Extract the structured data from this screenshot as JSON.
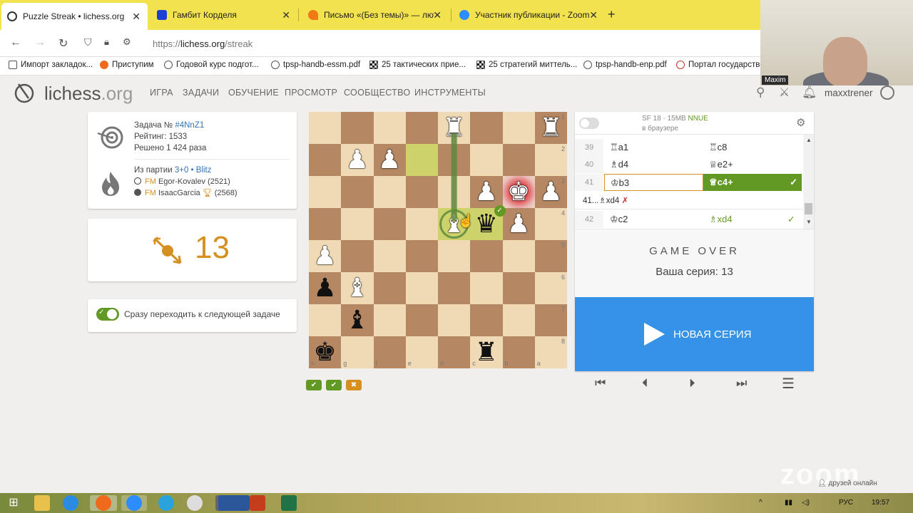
{
  "browser": {
    "tabs": [
      {
        "title": "Puzzle Streak • lichess.org",
        "active": true
      },
      {
        "title": "Гамбит Корделя",
        "active": false
      },
      {
        "title": "Письмо «(Без темы)» — люты",
        "active": false
      },
      {
        "title": "Участник публикации - Zoom",
        "active": false
      }
    ],
    "url_prefix": "https://",
    "url_host": "lichess.org",
    "url_path": "/streak",
    "bookmarks": [
      "Импорт закладок...",
      "Приступим",
      "Годовой курс подгот...",
      "tpsp-handb-essm.pdf",
      "25 тактических прие...",
      "25 стратегий миттель...",
      "tpsp-handb-enp.pdf",
      "Портал государстве"
    ]
  },
  "webcam": {
    "name": "Maxim"
  },
  "lichess": {
    "logo_main": "lichess",
    "logo_tld": ".org",
    "nav": [
      "ИГРА",
      "ЗАДАЧИ",
      "ОБУЧЕНИЕ",
      "ПРОСМОТР",
      "СООБЩЕСТВО",
      "ИНСТРУМЕНТЫ"
    ],
    "username": "maxxtrener"
  },
  "puzzle": {
    "label": "Задача №",
    "id": "#4NnZ1",
    "rating": "Рейтинг: 1533",
    "solved": "Решено 1 424 раза",
    "from_game": "Из партии",
    "time_control": "3+0",
    "speed": "• Blitz",
    "white_title": "FM",
    "white_player": "Egor-Kovalev (2521)",
    "black_title": "FM",
    "black_player": "IsaacGarcia",
    "black_rating": "(2568)",
    "streak": "13",
    "auto_next": "Сразу переходить к следующей задаче",
    "auto_next_on": true
  },
  "board": {
    "files": [
      "h",
      "g",
      "f",
      "e",
      "d",
      "c",
      "b",
      "a"
    ],
    "ranks": [
      "1",
      "2",
      "3",
      "4",
      "5",
      "6",
      "7",
      "8"
    ],
    "pieces": [
      {
        "sq": "d1",
        "glyph": "♜",
        "color": "w"
      },
      {
        "sq": "a1",
        "glyph": "♜",
        "color": "w"
      },
      {
        "sq": "g2",
        "glyph": "♟",
        "color": "w"
      },
      {
        "sq": "f2",
        "glyph": "♟",
        "color": "w"
      },
      {
        "sq": "c3",
        "glyph": "♟",
        "color": "w"
      },
      {
        "sq": "b3",
        "glyph": "♚",
        "color": "w"
      },
      {
        "sq": "a3",
        "glyph": "♟",
        "color": "w"
      },
      {
        "sq": "d4",
        "glyph": "♝",
        "color": "w"
      },
      {
        "sq": "c4",
        "glyph": "♛",
        "color": "b"
      },
      {
        "sq": "b4",
        "glyph": "♟",
        "color": "w"
      },
      {
        "sq": "h5",
        "glyph": "♟",
        "color": "w"
      },
      {
        "sq": "h6",
        "glyph": "♟",
        "color": "b"
      },
      {
        "sq": "g6",
        "glyph": "♝",
        "color": "w"
      },
      {
        "sq": "g7",
        "glyph": "♝",
        "color": "b"
      },
      {
        "sq": "h8",
        "glyph": "♚",
        "color": "b"
      },
      {
        "sq": "c8",
        "glyph": "♜",
        "color": "b"
      }
    ],
    "highlights": [
      {
        "sq": "e2",
        "color": "#cdd26a"
      },
      {
        "sq": "c4",
        "color": "#cdd26a"
      },
      {
        "sq": "d4",
        "color": "#cdd26a"
      }
    ],
    "check_square": "b3",
    "arrow": {
      "from": "d1",
      "to": "d4",
      "color": "#5c8a3d"
    },
    "result_icons": [
      "✔",
      "✔",
      "✖"
    ]
  },
  "engine": {
    "name": "SF 18 · 15MB",
    "nnue": "NNUE",
    "location": "в браузере"
  },
  "moves": [
    {
      "num": "39",
      "white": "♖a1",
      "black": "♖c8"
    },
    {
      "num": "40",
      "white": "♗d4",
      "black": "♕e2+"
    },
    {
      "num": "41",
      "white": "♔b3",
      "black": "♕c4+",
      "black_good": true
    },
    {
      "num": "41...",
      "white": "♗xd4",
      "wrong": "✗"
    },
    {
      "num": "42",
      "white": "♔c2",
      "black": "♗xd4",
      "black_good": true
    }
  ],
  "gameover": {
    "title": "GAME OVER",
    "streak_text": "Ваша серия: 13"
  },
  "new_series": "НОВАЯ СЕРИЯ",
  "taskbar": {
    "lang": "РУС",
    "time": "19:57",
    "friends": "друзей онлайн",
    "zoom_watermark": "zoom"
  }
}
